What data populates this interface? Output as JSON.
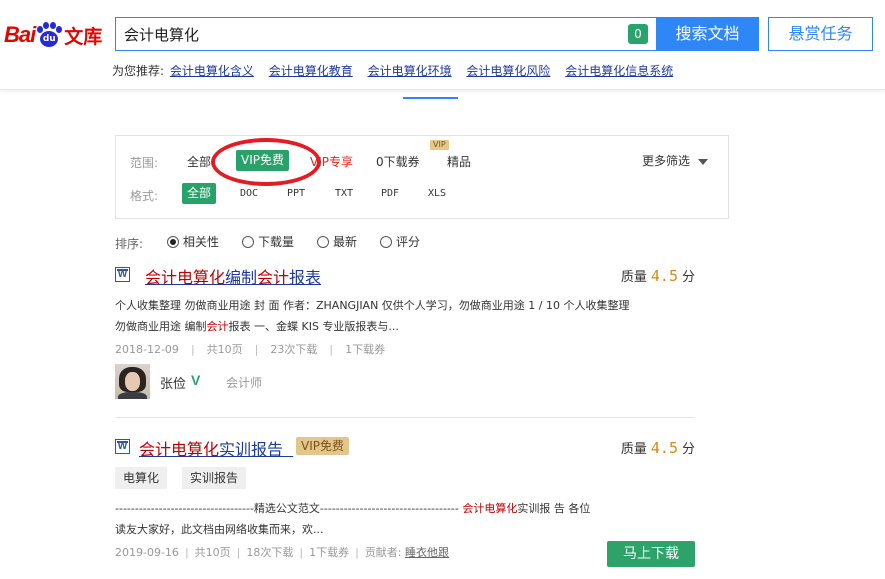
{
  "header": {
    "logo": {
      "bai": "Bai",
      "du": "du",
      "wenku": "文库"
    },
    "search": {
      "value": "会计电算化",
      "count": "0"
    },
    "search_button": "搜索文档",
    "reward_button": "悬赏任务",
    "recommend": {
      "label": "为您推荐:",
      "links": [
        "会计电算化含义",
        "会计电算化教育",
        "会计电算化环境",
        "会计电算化风险",
        "会计电算化信息系统"
      ]
    }
  },
  "filter": {
    "scope_label": "范围:",
    "scope_items": [
      "全部",
      "VIP免费",
      "VIP专享",
      "0下载券",
      "精品"
    ],
    "scope_vip_badge": "VIP",
    "format_label": "格式:",
    "format_items": [
      "全部",
      "DOC",
      "PPT",
      "TXT",
      "PDF",
      "XLS"
    ],
    "more": "更多筛选"
  },
  "sort": {
    "label": "排序:",
    "options": [
      "相关性",
      "下载量",
      "最新",
      "评分"
    ],
    "selected": "相关性"
  },
  "results": [
    {
      "icon": "W",
      "title_hl1": "会计电算化",
      "title_mid": "编制",
      "title_hl2": "会计",
      "title_end": "报表",
      "quality_label": "质量",
      "score": "4.5",
      "score_unit": "分",
      "snippet_line1": "个人收集整理 勿做商业用途 封 面 作者：ZHANGJIAN 仅供个人学习，勿做商业用途 1 / 10 个人收集整理",
      "snippet_line2_a": "勿做商业用途 编制",
      "snippet_line2_hl": "会计",
      "snippet_line2_b": "报表 一、金蝶 KIS 专业版报表与...",
      "date": "2018-12-09",
      "pages": "共10页",
      "downloads": "23次下载",
      "coupons": "1下载券",
      "author": "张俭",
      "author_badge": "V",
      "author_title": "会计师"
    },
    {
      "icon": "W",
      "title_hl1": "会计电算化",
      "title_end": "实训报告",
      "vip_tag": "VIP免费",
      "quality_label": "质量",
      "score": "4.5",
      "score_unit": "分",
      "tags": [
        "电算化",
        "实训报告"
      ],
      "snippet_line1_a": "-----------------------------------精选公文范文----------------------------------- ",
      "snippet_line1_hl": "会计电算化",
      "snippet_line1_b": "实训报 告 各位",
      "snippet_line2": "读友大家好，此文档由网络收集而来，欢...",
      "date": "2019-09-16",
      "pages": "共10页",
      "downloads": "18次下载",
      "coupons": "1下载券",
      "contributor_label": "贡献者:",
      "contributor": "睡衣他跟",
      "download_button": "马上下载"
    }
  ],
  "colors": {
    "accent": "#2f86f6",
    "green": "#27a269",
    "highlight_red": "#c00000",
    "annotation": "#e31b23"
  }
}
